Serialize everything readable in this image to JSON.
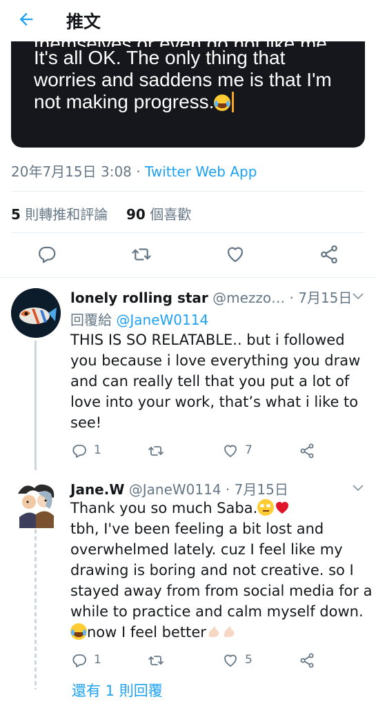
{
  "header": {
    "title": "推文",
    "back_icon": "arrow-left-icon"
  },
  "media": {
    "lines": [
      "themselves or even do not like me.",
      "It's all OK. The only thing that",
      "worries and saddens me is that I'm",
      "not making progress."
    ],
    "emoji": "laughing-crying-emoji"
  },
  "meta": {
    "time": "20年7月15日 3:08 · ",
    "source": "Twitter Web App"
  },
  "stats": {
    "retweets_count": "5",
    "retweets_label": " 則轉推和評論",
    "likes_count": "90",
    "likes_label": " 個喜歡"
  },
  "actions": [
    "reply-icon",
    "retweet-icon",
    "like-icon",
    "share-icon"
  ],
  "replies": [
    {
      "display_name": "lonely rolling star",
      "handle": " @mezzo…",
      "time": " · 7月15日",
      "replying_prefix": "回覆給 ",
      "replying_to": "@JaneW0114",
      "lines": [
        "THIS IS SO RELATABLE.. but i followed",
        "you because i love everything you draw",
        "and can really tell that you put a lot of",
        "love into your work, that’s what i like to",
        "see!"
      ],
      "reply_count": "1",
      "like_count": "7"
    },
    {
      "display_name": "Jane.W",
      "handle": " @JaneW0114",
      "time": " · 7月15日",
      "lines": [
        "Thank you so much Saba.",
        "tbh, I've been feeling a bit lost and",
        "overwhelmed lately. cuz I feel like my",
        "drawing is boring and not creative. so I",
        "stayed away from from social media for a",
        "while to practice and calm myself down.",
        "now I feel better"
      ],
      "reply_count": "1",
      "like_count": "5"
    }
  ],
  "more_replies": "還有 1 則回覆",
  "colors": {
    "accent": "#1da1f2",
    "muted": "#657786",
    "media_bg": "#15171c"
  }
}
